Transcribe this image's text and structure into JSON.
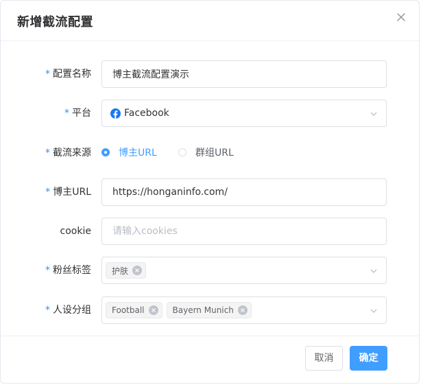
{
  "dialog": {
    "title": "新增截流配置"
  },
  "form": {
    "config_name": {
      "label": "配置名称",
      "required_mark": "*",
      "value": "博主截流配置演示"
    },
    "platform": {
      "label": "平台",
      "required_mark": "*",
      "value": "Facebook",
      "icon": "facebook-icon",
      "icon_color": "#1877f2"
    },
    "source": {
      "label": "截流来源",
      "required_mark": "*",
      "options": [
        {
          "label": "博主URL",
          "selected": true
        },
        {
          "label": "群组URL",
          "selected": false
        }
      ]
    },
    "blogger_url": {
      "label": "博主URL",
      "required_mark": "*",
      "value": "https://honganinfo.com/"
    },
    "cookie": {
      "label": "cookie",
      "value": "",
      "placeholder": "请输入cookies"
    },
    "fan_tags": {
      "label": "粉丝标签",
      "required_mark": "*",
      "tags": [
        "护肤"
      ]
    },
    "persona_group": {
      "label": "人设分组",
      "required_mark": "*",
      "tags": [
        "Football",
        "Bayern Munich"
      ]
    }
  },
  "footer": {
    "cancel_label": "取消",
    "confirm_label": "确定"
  },
  "colors": {
    "primary": "#409eff",
    "required": "#3a8ee6",
    "border": "#dcdfe6",
    "tag_bg": "#f4f4f5"
  }
}
